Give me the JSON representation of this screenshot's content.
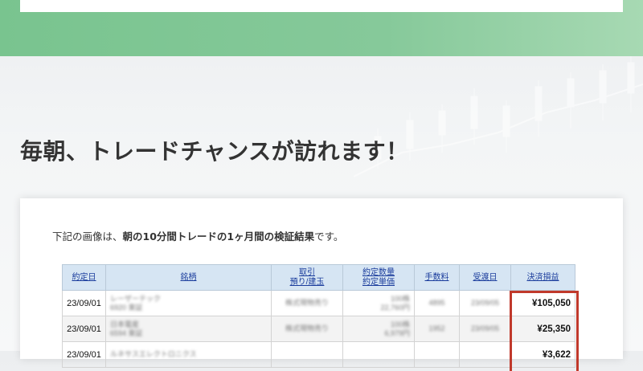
{
  "heading": "毎朝、トレードチャンスが訪れます！",
  "intro": {
    "prefix": "下記の画像は、",
    "bold": "朝の10分間トレードの1ヶ月間の検証結果",
    "suffix": "です。"
  },
  "table": {
    "headers": [
      {
        "line1": "約定日",
        "line2": ""
      },
      {
        "line1": "銘柄",
        "line2": ""
      },
      {
        "line1": "取引",
        "line2": "預り/建玉"
      },
      {
        "line1": "約定数量",
        "line2": "約定単価"
      },
      {
        "line1": "手数料",
        "line2": ""
      },
      {
        "line1": "受渡日",
        "line2": ""
      },
      {
        "line1": "決済損益",
        "line2": ""
      }
    ],
    "rows": [
      {
        "date": "23/09/01",
        "name": "レーザーテック",
        "code": "6920 東証",
        "trade": "株式現物売り",
        "qty": "100株",
        "price": "22,760円",
        "fee": "4895",
        "settle": "23/09/05",
        "pl": "¥105,050"
      },
      {
        "date": "23/09/01",
        "name": "日本電産",
        "code": "6594 東証",
        "trade": "株式現物売り",
        "qty": "100株",
        "price": "6,979円",
        "fee": "1952",
        "settle": "23/09/05",
        "pl": "¥25,350"
      },
      {
        "date": "23/09/01",
        "name": "ルネサスエレクトロニクス",
        "code": "",
        "trade": "",
        "qty": "",
        "price": "",
        "fee": "",
        "settle": "",
        "pl": "¥3,622"
      }
    ]
  },
  "colors": {
    "accent_green": "#79c48f",
    "header_blue": "#d6e5f3",
    "link_blue": "#1a3c9c",
    "highlight_red": "#c0392b"
  }
}
